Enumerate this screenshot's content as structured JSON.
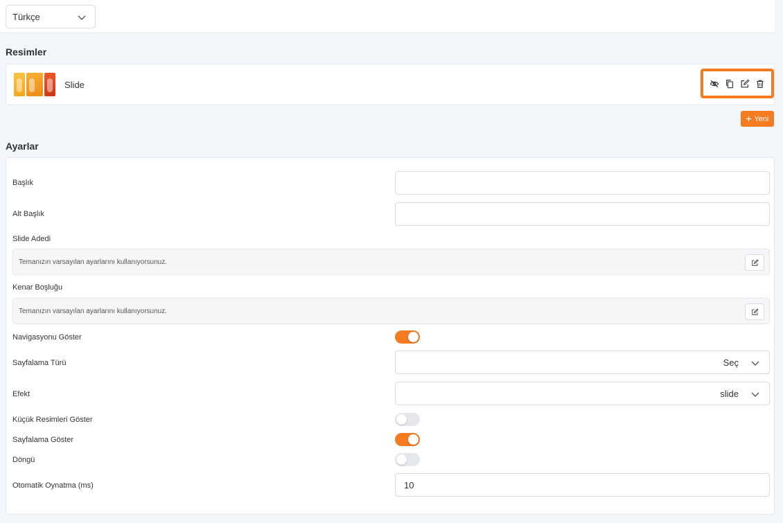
{
  "language_selector": {
    "value": "Türkçe"
  },
  "images_section": {
    "title": "Resimler",
    "items": [
      {
        "name": "Slide"
      }
    ],
    "new_button_label": "Yeni"
  },
  "settings_section": {
    "title": "Ayarlar",
    "fields": {
      "title": {
        "label": "Başlık",
        "value": ""
      },
      "subtitle": {
        "label": "Alt Başlık",
        "value": ""
      },
      "slide_count": {
        "label": "Slide Adedi",
        "default_text": "Temanızın varsayılan ayarlarını kullanıyorsunuz."
      },
      "spacing": {
        "label": "Kenar Boşluğu",
        "default_text": "Temanızın varsayılan ayarlarını kullanıyorsunuz."
      },
      "show_navigation": {
        "label": "Navigasyonu Göster",
        "enabled": true
      },
      "pagination_type": {
        "label": "Sayfalama Türü",
        "value": "Seç"
      },
      "effect": {
        "label": "Efekt",
        "value": "slide"
      },
      "show_thumbnails": {
        "label": "Küçük Resimleri Göster",
        "enabled": false
      },
      "show_pagination": {
        "label": "Sayfalama Göster",
        "enabled": true
      },
      "loop": {
        "label": "Döngü",
        "enabled": false
      },
      "autoplay": {
        "label": "Otomatik Oynatma (ms)",
        "value": "10"
      }
    }
  },
  "colors": {
    "accent": "#f47b20",
    "background": "#f2f6f8",
    "toggle_off": "#e4e8ec"
  },
  "icons": [
    "chevron-down-icon",
    "eye-slash-icon",
    "copy-icon",
    "edit-icon",
    "trash-icon",
    "plus-icon"
  ]
}
